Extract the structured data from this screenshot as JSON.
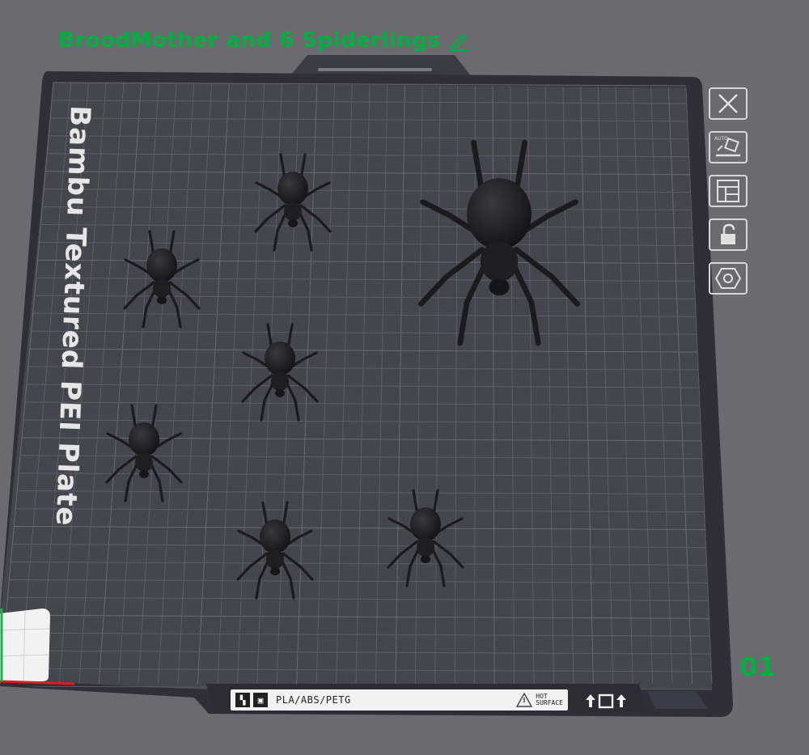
{
  "header": {
    "plate_name": "BroodMother and 6 Spiderlings",
    "edit_icon": "pencil-icon"
  },
  "plate": {
    "bed_title": "Bambu Textured PEI Plate",
    "number": "01",
    "material_label": "PLA/ABS/PETG",
    "hot_line1": "HOT",
    "hot_line2": "SURFACE",
    "colors": {
      "accent": "#00ae42",
      "bed": "#45454c",
      "grid": "#5f6069",
      "background": "#6b6b6f"
    }
  },
  "objects": [
    {
      "name": "Spiderling 1"
    },
    {
      "name": "Spiderling 2"
    },
    {
      "name": "Spiderling 3"
    },
    {
      "name": "Spiderling 4"
    },
    {
      "name": "Spiderling 5"
    },
    {
      "name": "Spiderling 6"
    },
    {
      "name": "BroodMother"
    }
  ],
  "toolbar": [
    {
      "name": "close-plate-button",
      "icon": "close-icon"
    },
    {
      "name": "auto-orient-button",
      "icon": "auto-orient-icon"
    },
    {
      "name": "arrange-button",
      "icon": "arrange-icon"
    },
    {
      "name": "lock-plate-button",
      "icon": "unlock-icon"
    },
    {
      "name": "plate-settings-button",
      "icon": "hexagon-settings-icon"
    }
  ]
}
